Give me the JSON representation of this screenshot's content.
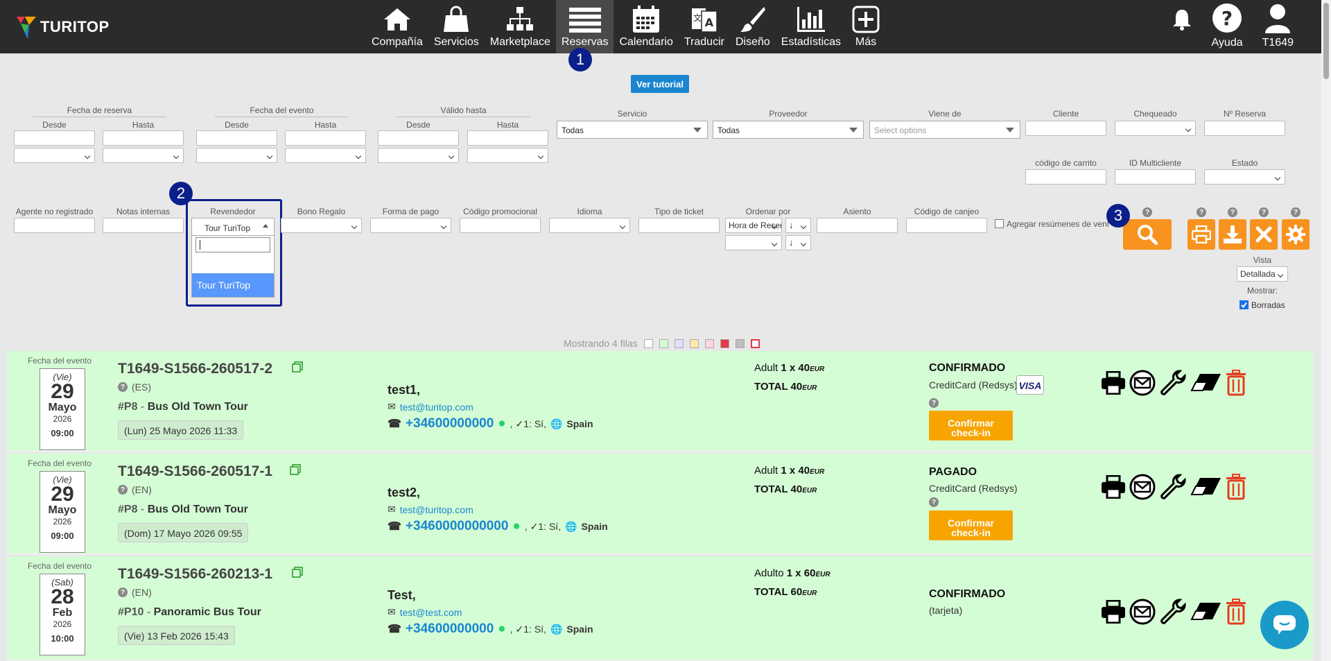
{
  "app": {
    "logo_text": "TURITOP"
  },
  "nav": [
    {
      "label": "Compañía",
      "icon": "home-icon"
    },
    {
      "label": "Servicios",
      "icon": "shopping-bag-icon"
    },
    {
      "label": "Marketplace",
      "icon": "sitemap-icon"
    },
    {
      "label": "Reservas",
      "icon": "list-icon",
      "active": true
    },
    {
      "label": "Calendario",
      "icon": "calendar-icon"
    },
    {
      "label": "Traducir",
      "icon": "translate-icon"
    },
    {
      "label": "Diseño",
      "icon": "brush-icon"
    },
    {
      "label": "Estadísticas",
      "icon": "bar-chart-icon"
    },
    {
      "label": "Más",
      "icon": "plus-icon"
    }
  ],
  "right_nav": {
    "notifications_icon": "bell-icon",
    "help_label": "Ayuda",
    "user_label": "T1649"
  },
  "badges": [
    "1",
    "2",
    "3"
  ],
  "tutorial_button": "Ver tutorial",
  "filters": {
    "fecha_reserva": "Fecha de reserva",
    "fecha_evento": "Fecha del evento",
    "valido_hasta": "Válido hasta",
    "desde": "Desde",
    "hasta": "Hasta",
    "servicio": {
      "label": "Servicio",
      "value": "Todas"
    },
    "proveedor": {
      "label": "Proveedor",
      "value": "Todas"
    },
    "viene_de": {
      "label": "Viene de",
      "placeholder": "Select options"
    },
    "cliente": "Cliente",
    "chequeado": "Chequeado",
    "n_reserva": "Nº Reserva",
    "codigo_carrito": "código de carrito",
    "id_multicliente": "ID Multicliente",
    "estado": "Estado",
    "agente": "Agente no registrado",
    "notas": "Notas internas",
    "revendedor": {
      "label": "Revendedor",
      "value": "Tour TuriTop",
      "option": "Tour TuriTop"
    },
    "bono": "Bono Regalo",
    "forma_pago": "Forma de pago",
    "codigo_promo": "Código promocional",
    "idioma": "Idioma",
    "tipo_ticket": "Tipo de ticket",
    "ordenar": {
      "label": "Ordenar por",
      "value": "Hora de Reserva",
      "dir1": "↓",
      "dir2": "↓"
    },
    "asiento": "Asiento",
    "codigo_canje": "Código de canjeo",
    "agregar_resumenes": "Agregar resúmenes de venta",
    "vista": {
      "label": "Vista",
      "value": "Detallada"
    },
    "mostrar": "Mostrar:",
    "borradas": "Borradas",
    "help_mark": "?"
  },
  "legend_text": "Mostrando 4 filas",
  "legend_colors": [
    "#ffffff",
    "#d5fdd5",
    "#dde0ff",
    "#ffe9a8",
    "#ffd6dc",
    "#e53946",
    "#bdbdbd",
    "#ffffff"
  ],
  "rows": [
    {
      "date_caption": "Fecha del evento",
      "dow": "(Vie)",
      "day": "29",
      "month": "Mayo",
      "year": "2026",
      "time": "09:00",
      "ref": "T1649-S1566-260517-2",
      "lang": "(ES)",
      "prod_num": "#P8",
      "prod_sep": " - ",
      "prod_name": "Bus Old Town Tour",
      "booked": "(Lun) 25 Mayo 2026 11:33",
      "name": "test1,",
      "email": "test@turitop.com",
      "phone": "+34600000000",
      "check": ", ✓1: Sí,",
      "country": "Spain",
      "price_line": "Adult",
      "price_qty": "1 x 40",
      "total_label": "TOTAL 40",
      "currency": "EUR",
      "status": "CONFIRMADO",
      "payment": "CreditCard (Redsys)",
      "card": "VISA",
      "checkin": "Confirmar check-in"
    },
    {
      "date_caption": "Fecha del evento",
      "dow": "(Vie)",
      "day": "29",
      "month": "Mayo",
      "year": "2026",
      "time": "09:00",
      "ref": "T1649-S1566-260517-1",
      "lang": "(EN)",
      "prod_num": "#P8",
      "prod_sep": " - ",
      "prod_name": "Bus Old Town Tour",
      "booked": "(Dom) 17 Mayo 2026 09:55",
      "name": "test2,",
      "email": "test@turitop.com",
      "phone": "+3460000000000",
      "check": ", ✓1: Sí,",
      "country": "Spain",
      "price_line": "Adult",
      "price_qty": "1 x 40",
      "total_label": "TOTAL 40",
      "currency": "EUR",
      "status": "PAGADO",
      "payment": "CreditCard (Redsys)",
      "card": "",
      "checkin": "Confirmar check-in"
    },
    {
      "date_caption": "Fecha del evento",
      "dow": "(Sab)",
      "day": "28",
      "month": "Feb",
      "year": "2026",
      "time": "10:00",
      "ref": "T1649-S1566-260213-1",
      "lang": "(EN)",
      "prod_num": "#P10",
      "prod_sep": " - ",
      "prod_name": "Panoramic Bus Tour",
      "booked": "(Vie) 13 Feb 2026 15:43",
      "name": "Test,",
      "email": "test@test.com",
      "phone": "+34600000000",
      "check": ", ✓1: Sí,",
      "country": "Spain",
      "price_line": "Adulto",
      "price_qty": "1 x 60",
      "total_label": "TOTAL 60",
      "currency": "EUR",
      "status": "CONFIRMADO",
      "payment": "(tarjeta)",
      "card": "",
      "checkin": ""
    }
  ],
  "colors": {
    "accent": "#f7931e",
    "badge": "#0b1f8a",
    "row_bg": "#d5fdd5",
    "link": "#1a86d0"
  }
}
